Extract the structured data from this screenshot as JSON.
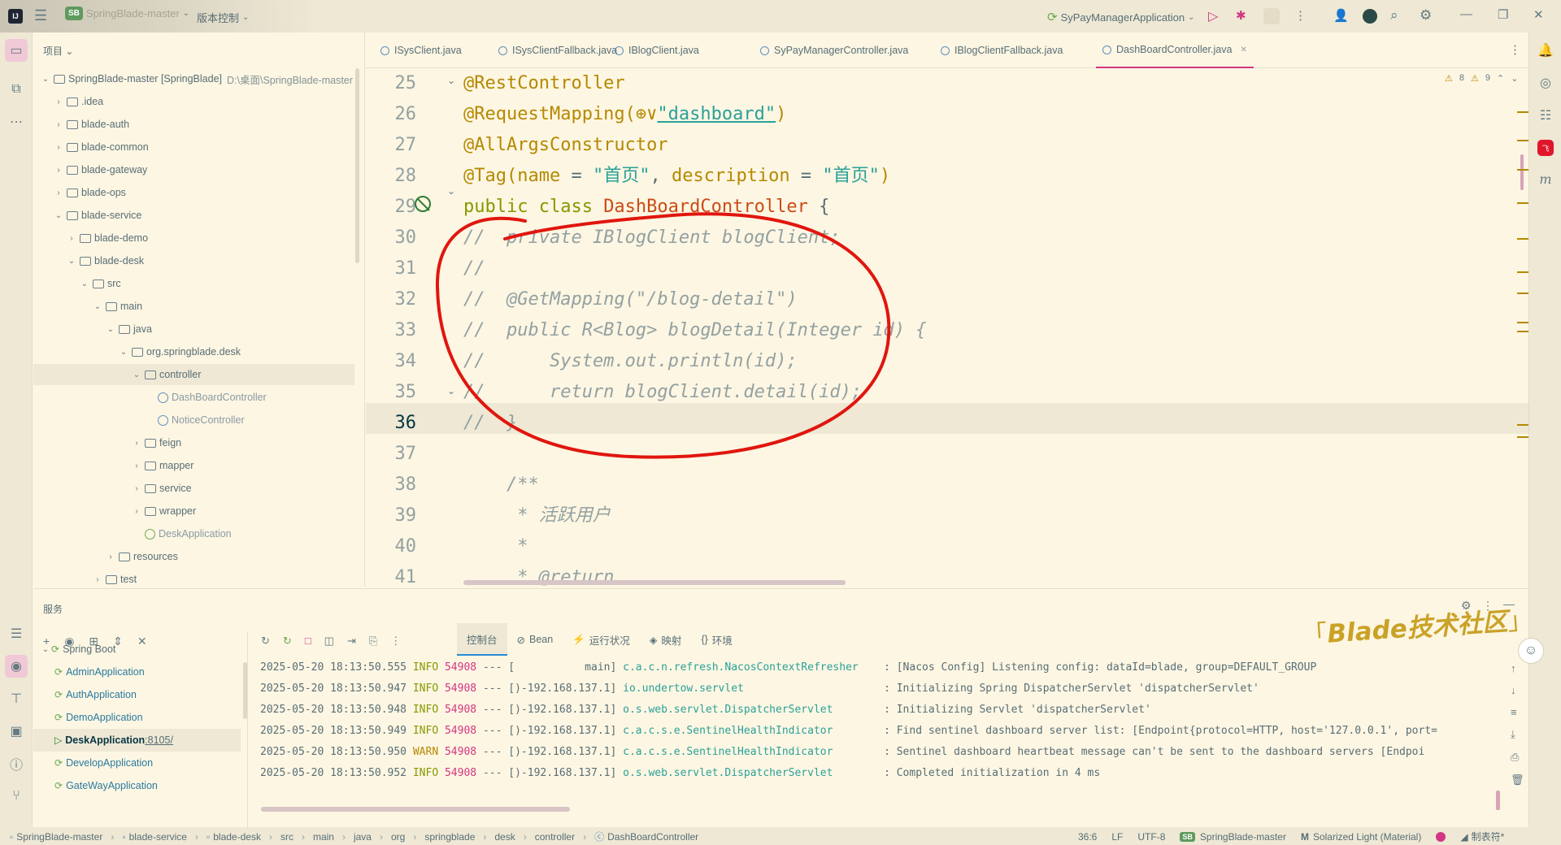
{
  "titlebar": {
    "project_badge": "SB",
    "project_name": "SpringBlade-master",
    "vcs_label": "版本控制",
    "run_config": "SyPayManagerApplication"
  },
  "project_panel": {
    "title": "项目",
    "tree": [
      {
        "label": "SpringBlade-master [SpringBlade]",
        "path": "D:\\桌面\\SpringBlade-master",
        "depth": 0,
        "kind": "module",
        "expanded": true
      },
      {
        "label": ".idea",
        "depth": 1,
        "kind": "folder",
        "expanded": false
      },
      {
        "label": "blade-auth",
        "depth": 1,
        "kind": "module",
        "expanded": false
      },
      {
        "label": "blade-common",
        "depth": 1,
        "kind": "module",
        "expanded": false
      },
      {
        "label": "blade-gateway",
        "depth": 1,
        "kind": "module",
        "expanded": false
      },
      {
        "label": "blade-ops",
        "depth": 1,
        "kind": "module",
        "expanded": false
      },
      {
        "label": "blade-service",
        "depth": 1,
        "kind": "module",
        "expanded": true
      },
      {
        "label": "blade-demo",
        "depth": 2,
        "kind": "module",
        "expanded": false
      },
      {
        "label": "blade-desk",
        "depth": 2,
        "kind": "module",
        "expanded": true
      },
      {
        "label": "src",
        "depth": 3,
        "kind": "folder",
        "expanded": true
      },
      {
        "label": "main",
        "depth": 4,
        "kind": "folder",
        "expanded": true
      },
      {
        "label": "java",
        "depth": 5,
        "kind": "folder",
        "expanded": true
      },
      {
        "label": "org.springblade.desk",
        "depth": 6,
        "kind": "package",
        "expanded": true
      },
      {
        "label": "controller",
        "depth": 7,
        "kind": "package",
        "expanded": true,
        "selected": true
      },
      {
        "label": "DashBoardController",
        "depth": 8,
        "kind": "class"
      },
      {
        "label": "NoticeController",
        "depth": 8,
        "kind": "class"
      },
      {
        "label": "feign",
        "depth": 7,
        "kind": "package",
        "expanded": false
      },
      {
        "label": "mapper",
        "depth": 7,
        "kind": "package",
        "expanded": false
      },
      {
        "label": "service",
        "depth": 7,
        "kind": "package",
        "expanded": false
      },
      {
        "label": "wrapper",
        "depth": 7,
        "kind": "package",
        "expanded": false
      },
      {
        "label": "DeskApplication",
        "depth": 7,
        "kind": "boot"
      },
      {
        "label": "resources",
        "depth": 5,
        "kind": "folder",
        "expanded": false
      },
      {
        "label": "test",
        "depth": 4,
        "kind": "folder",
        "expanded": false
      }
    ]
  },
  "editor_tabs": [
    {
      "label": "ISysClient.java"
    },
    {
      "label": "ISysClientFallback.java"
    },
    {
      "label": "IBlogClient.java"
    },
    {
      "label": "SyPayManagerController.java"
    },
    {
      "label": "IBlogClientFallback.java"
    },
    {
      "label": "DashBoardController.java",
      "active": true
    }
  ],
  "inspections": {
    "warnings": "8",
    "weak": "9"
  },
  "code": {
    "lines": [
      {
        "n": "25",
        "parts": [
          {
            "t": "@RestController",
            "c": "ann"
          }
        ]
      },
      {
        "n": "26",
        "parts": [
          {
            "t": "@RequestMapping(",
            "c": "ann"
          },
          {
            "t": "⊕∨",
            "c": "ann"
          },
          {
            "t": "\"dashboard\"",
            "c": "str"
          },
          {
            "t": ")",
            "c": "ann"
          }
        ]
      },
      {
        "n": "27",
        "parts": [
          {
            "t": "@AllArgsConstructor",
            "c": "ann"
          }
        ]
      },
      {
        "n": "28",
        "parts": [
          {
            "t": "@Tag(",
            "c": "ann"
          },
          {
            "t": "name",
            "c": "name"
          },
          {
            "t": " = ",
            "c": ""
          },
          {
            "t": "\"首页\"",
            "c": "str"
          },
          {
            "t": ", ",
            "c": ""
          },
          {
            "t": "description",
            "c": "name"
          },
          {
            "t": " = ",
            "c": ""
          },
          {
            "t": "\"首页\"",
            "c": "str"
          },
          {
            "t": ")",
            "c": "ann"
          }
        ]
      },
      {
        "n": "29",
        "parts": [
          {
            "t": "public class ",
            "c": "kw"
          },
          {
            "t": "DashBoardController",
            "c": "cls-name"
          },
          {
            "t": " {",
            "c": ""
          }
        ]
      },
      {
        "n": "30",
        "parts": [
          {
            "t": "//  private IBlogClient blogClient;",
            "c": "cmt"
          }
        ]
      },
      {
        "n": "31",
        "parts": [
          {
            "t": "//",
            "c": "cmt"
          }
        ]
      },
      {
        "n": "32",
        "parts": [
          {
            "t": "//  @GetMapping(\"/blog-detail\")",
            "c": "cmt"
          }
        ]
      },
      {
        "n": "33",
        "parts": [
          {
            "t": "//  public R<Blog> blogDetail(Integer id) {",
            "c": "cmt"
          }
        ]
      },
      {
        "n": "34",
        "parts": [
          {
            "t": "//      System.out.println(id);",
            "c": "cmt"
          }
        ]
      },
      {
        "n": "35",
        "parts": [
          {
            "t": "//      return blogClient.detail(id);",
            "c": "cmt"
          }
        ]
      },
      {
        "n": "36",
        "parts": [
          {
            "t": "//  }",
            "c": "cmt"
          }
        ],
        "current": true
      },
      {
        "n": "37",
        "parts": [
          {
            "t": "",
            "c": ""
          }
        ]
      },
      {
        "n": "38",
        "parts": [
          {
            "t": "    /**",
            "c": "cmt"
          }
        ]
      },
      {
        "n": "39",
        "parts": [
          {
            "t": "     * 活跃用户",
            "c": "cmt"
          }
        ]
      },
      {
        "n": "40",
        "parts": [
          {
            "t": "     *",
            "c": "cmt"
          }
        ]
      },
      {
        "n": "41",
        "parts": [
          {
            "t": "     * @return",
            "c": "cmt"
          }
        ]
      }
    ]
  },
  "services": {
    "title": "服务",
    "tree": [
      {
        "label": "Spring Boot",
        "depth": 0,
        "expanded": true
      },
      {
        "label": "AdminApplication",
        "depth": 1
      },
      {
        "label": "AuthApplication",
        "depth": 1
      },
      {
        "label": "DemoApplication",
        "depth": 1
      },
      {
        "label": "DeskApplication",
        "port": ":8105/",
        "depth": 1,
        "selected": true,
        "running": true
      },
      {
        "label": "DevelopApplication",
        "depth": 1
      },
      {
        "label": "GateWayApplication",
        "depth": 1
      }
    ],
    "console_tabs": [
      {
        "label": "控制台",
        "active": true
      },
      {
        "label": "Bean"
      },
      {
        "label": "运行状况"
      },
      {
        "label": "映射"
      },
      {
        "label": "环境"
      }
    ],
    "log": [
      {
        "ts": "2025-05-20 18:13:50.555",
        "lvl": "INFO",
        "pid": "54908",
        "thread": "--- [           main]",
        "logger": "c.a.c.n.refresh.NacosContextRefresher",
        "msg": ": [Nacos Config] Listening config: dataId=blade, group=DEFAULT_GROUP"
      },
      {
        "ts": "2025-05-20 18:13:50.947",
        "lvl": "INFO",
        "pid": "54908",
        "thread": "--- [)-192.168.137.1]",
        "logger": "io.undertow.servlet",
        "msg": ": Initializing Spring DispatcherServlet 'dispatcherServlet'"
      },
      {
        "ts": "2025-05-20 18:13:50.948",
        "lvl": "INFO",
        "pid": "54908",
        "thread": "--- [)-192.168.137.1]",
        "logger": "o.s.web.servlet.DispatcherServlet",
        "msg": ": Initializing Servlet 'dispatcherServlet'"
      },
      {
        "ts": "2025-05-20 18:13:50.949",
        "lvl": "INFO",
        "pid": "54908",
        "thread": "--- [)-192.168.137.1]",
        "logger": "c.a.c.s.e.SentinelHealthIndicator",
        "msg": ": Find sentinel dashboard server list: [Endpoint{protocol=HTTP, host='127.0.0.1', port="
      },
      {
        "ts": "2025-05-20 18:13:50.950",
        "lvl": "WARN",
        "pid": "54908",
        "thread": "--- [)-192.168.137.1]",
        "logger": "c.a.c.s.e.SentinelHealthIndicator",
        "msg": ": Sentinel dashboard heartbeat message can't be sent to the dashboard servers [Endpoi"
      },
      {
        "ts": "2025-05-20 18:13:50.952",
        "lvl": "INFO",
        "pid": "54908",
        "thread": "--- [)-192.168.137.1]",
        "logger": "o.s.web.servlet.DispatcherServlet",
        "msg": ": Completed initialization in 4 ms"
      }
    ]
  },
  "watermark": "Blade技术社区",
  "statusbar": {
    "crumbs": [
      "SpringBlade-master",
      "blade-service",
      "blade-desk",
      "src",
      "main",
      "java",
      "org",
      "springblade",
      "desk",
      "controller",
      "DashBoardController"
    ],
    "position": "36:6",
    "line_sep": "LF",
    "encoding": "UTF-8",
    "project_badge": "SB",
    "project": "SpringBlade-master",
    "theme": "Solarized Light (Material)",
    "tab_mode": "制表符*"
  },
  "colors": {
    "accent": "#d33682",
    "annotation_circle": "#e0160e",
    "watermark": "#c9a227"
  }
}
